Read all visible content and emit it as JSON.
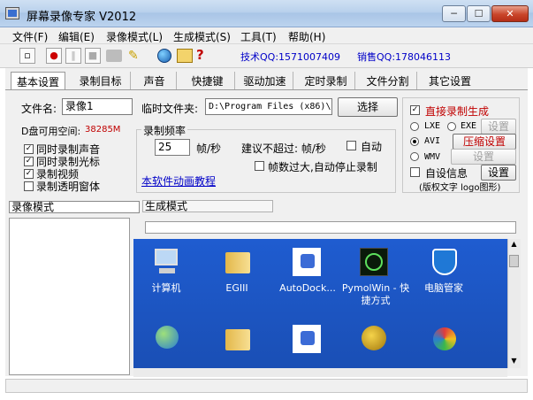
{
  "window": {
    "title": "屏幕录像专家 V2012",
    "min": "─",
    "max": "☐",
    "close": "✕"
  },
  "menu": [
    "文件(F)",
    "编辑(E)",
    "录像模式(L)",
    "生成模式(S)",
    "工具(T)",
    "帮助(H)"
  ],
  "toolbar": {
    "tech_qq": "技术QQ:1571007409",
    "sales_qq": "销售QQ:178046113",
    "help": "?"
  },
  "tabs": [
    "基本设置",
    "录制目标",
    "声音",
    "快捷键",
    "驱动加速",
    "定时录制",
    "文件分割",
    "其它设置"
  ],
  "basic": {
    "filename_label": "文件名:",
    "filename_value": "录像1",
    "tempdir_label": "临时文件夹:",
    "tempdir_value": "D:\\Program Files (x86)\\",
    "select_btn": "选择",
    "disk_label": "D盘可用空间:",
    "disk_value": "38285M",
    "checks": [
      {
        "label": "同时录制声音",
        "checked": true
      },
      {
        "label": "同时录制光标",
        "checked": true
      },
      {
        "label": "录制视频",
        "checked": true
      },
      {
        "label": "录制透明窗体",
        "checked": false
      }
    ],
    "fps_group": "录制频率",
    "fps_value": "25",
    "fps_unit": "帧/秒",
    "fps_suggest": "建议不超过: 帧/秒",
    "auto_label": "自动",
    "auto_stop_label": "帧数过大,自动停止录制",
    "tutorial_link": "本软件动画教程",
    "direct_label": "直接录制生成",
    "formats": [
      {
        "label": "LXE",
        "selected": false
      },
      {
        "label": "EXE",
        "selected": false
      },
      {
        "label": "AVI",
        "selected": true
      },
      {
        "label": "WMV",
        "selected": false
      }
    ],
    "settings_btn": "设置",
    "compress_btn": "压缩设置",
    "self_info_label": "自设信息",
    "self_info_btn": "设置",
    "copyright_note": "(版权文字 logo图形)"
  },
  "lower": {
    "left_tab": "录像模式",
    "right_tab": "生成模式",
    "desktop_icons": [
      {
        "label": "计算机",
        "icon": "computer-icon"
      },
      {
        "label": "EGIII",
        "icon": "folder-icon"
      },
      {
        "label": "AutoDock...",
        "icon": "shortcut-icon"
      },
      {
        "label": "PymolWin - 快捷方式",
        "icon": "pymol-icon"
      },
      {
        "label": "电脑管家",
        "icon": "shield-icon"
      }
    ]
  },
  "colors": {
    "accent_red": "#c00000",
    "link_blue": "#0000c8",
    "desktop_blue": "#1b55c4"
  }
}
